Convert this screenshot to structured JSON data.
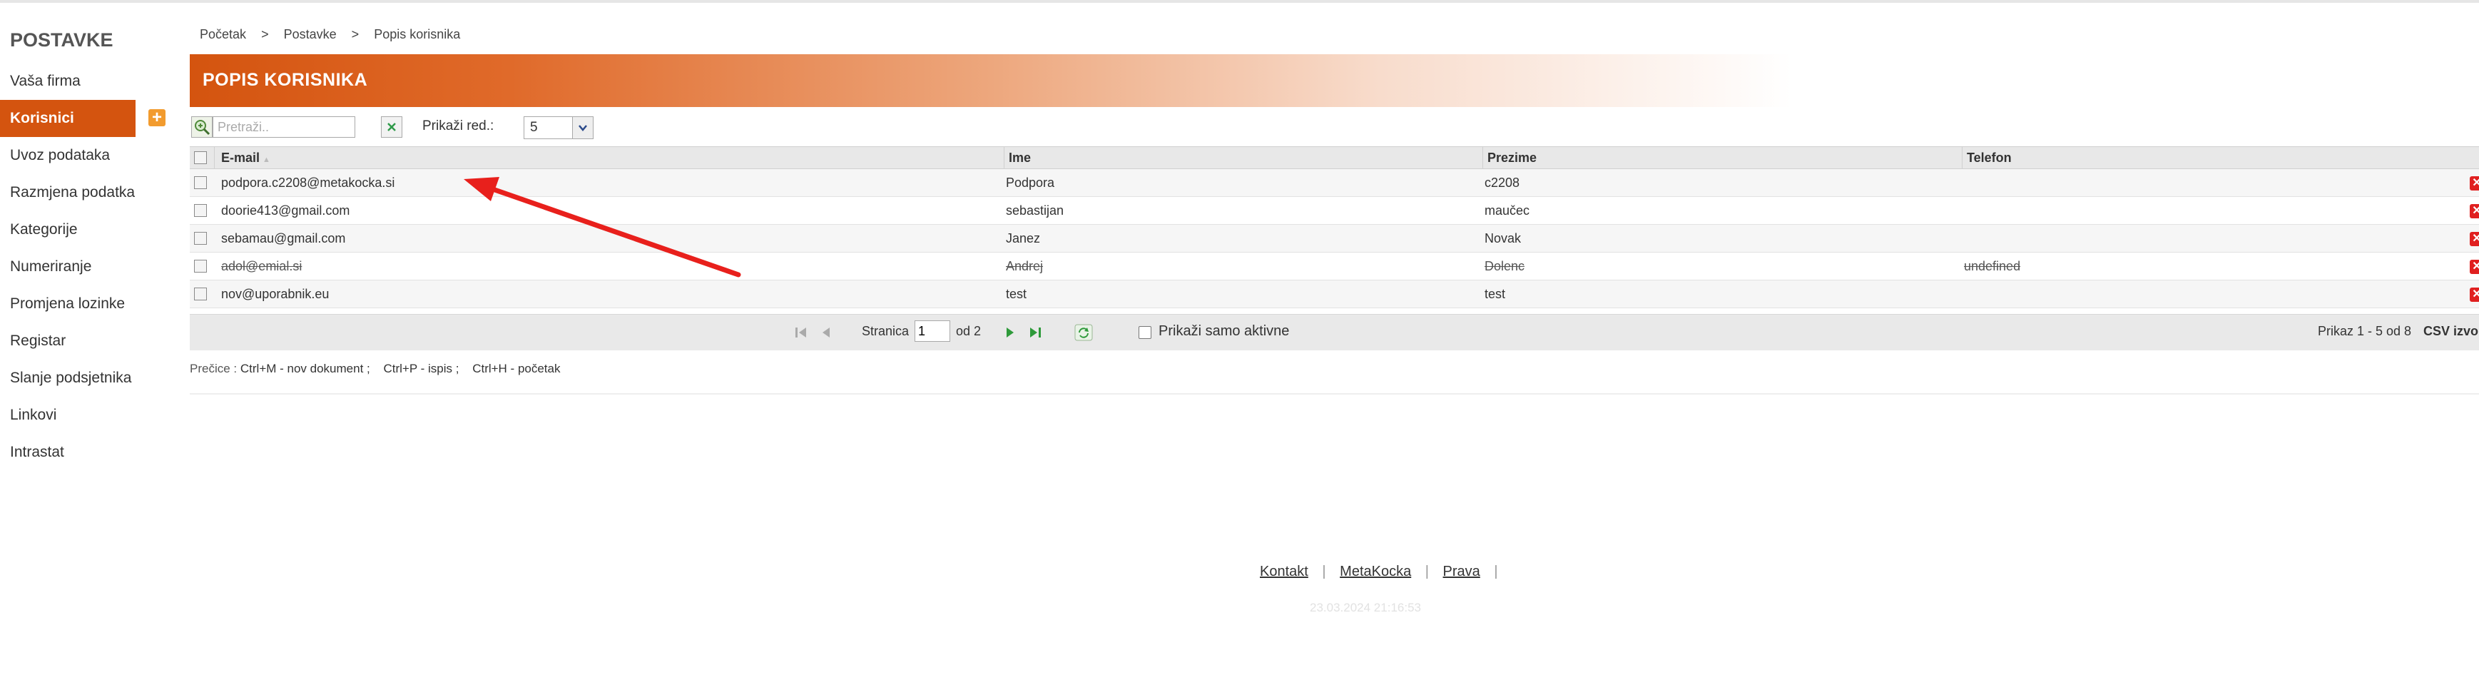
{
  "sidebar": {
    "title": "POSTAVKE",
    "items": [
      {
        "label": "Vaša firma"
      },
      {
        "label": "Korisnici"
      },
      {
        "label": "Uvoz podataka"
      },
      {
        "label": "Razmjena podatka"
      },
      {
        "label": "Kategorije"
      },
      {
        "label": "Numeriranje"
      },
      {
        "label": "Promjena lozinke"
      },
      {
        "label": "Registar"
      },
      {
        "label": "Slanje podsjetnika"
      },
      {
        "label": "Linkovi"
      },
      {
        "label": "Intrastat"
      }
    ],
    "add_symbol": "+"
  },
  "breadcrumb": [
    "Početak",
    "Postavke",
    "Popis korisnika"
  ],
  "breadcrumb_separator": ">",
  "page": {
    "title": "POPIS KORISNIKA"
  },
  "toolbar": {
    "search_placeholder": "Pretraži..",
    "rows_label": "Prikaži red.:",
    "rows_value": "5"
  },
  "grid": {
    "columns": [
      "E-mail",
      "Ime",
      "Prezime",
      "Telefon"
    ],
    "rows": [
      {
        "email": "podpora.c2208@metakocka.si",
        "ime": "Podpora",
        "prezime": "c2208",
        "telefon": "",
        "inactive": false
      },
      {
        "email": "doorie413@gmail.com",
        "ime": "sebastijan",
        "prezime": "maučec",
        "telefon": "",
        "inactive": false
      },
      {
        "email": "sebamau@gmail.com",
        "ime": "Janez",
        "prezime": "Novak",
        "telefon": "",
        "inactive": false
      },
      {
        "email": "adol@emial.si",
        "ime": "Andrej",
        "prezime": "Dolenc",
        "telefon": "undefined",
        "inactive": true
      },
      {
        "email": "nov@uporabnik.eu",
        "ime": "test",
        "prezime": "test",
        "telefon": "",
        "inactive": false
      }
    ]
  },
  "pager": {
    "page_label": "Stranica",
    "page_value": "1",
    "page_of": "od 2",
    "active_only_label": "Prikaži samo aktivne",
    "records": "Prikaz 1 - 5 od 8",
    "csv": "CSV izvo"
  },
  "shortcuts": {
    "label": "Prečice :",
    "items": [
      "Ctrl+M - nov dokument ;",
      "Ctrl+P - ispis ;",
      "Ctrl+H - početak"
    ]
  },
  "footer": {
    "links": [
      "Kontakt",
      "MetaKocka",
      "Prava"
    ],
    "separator": "|",
    "timestamp": "23.03.2024 21:16:53"
  },
  "colors": {
    "accent": "#d4540f",
    "annotation_arrow": "#e8201c",
    "delete": "#e02020"
  }
}
